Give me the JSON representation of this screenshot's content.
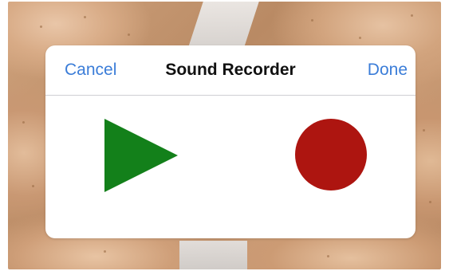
{
  "dialog": {
    "title": "Sound Recorder",
    "cancel_label": "Cancel",
    "done_label": "Done"
  },
  "controls": {
    "play_icon": "play-icon",
    "record_icon": "record-icon"
  },
  "colors": {
    "accent": "#3b7dd8",
    "play": "#13801a",
    "record": "#ad1510"
  }
}
